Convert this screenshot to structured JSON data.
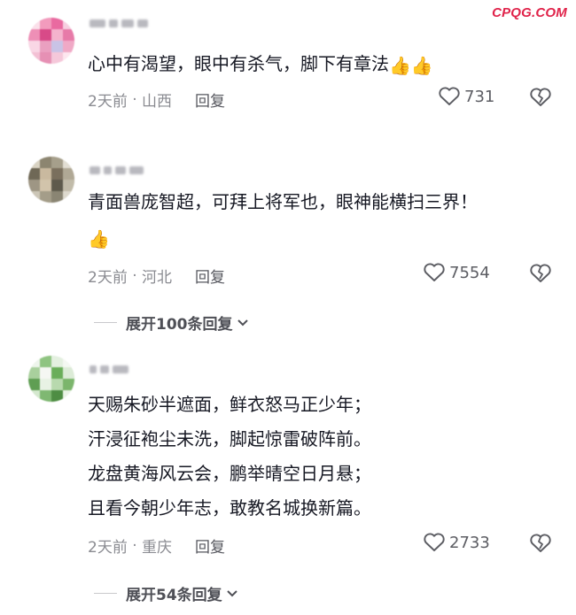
{
  "watermark": "CPQG.COM",
  "comments": [
    {
      "lines": [
        "心中有渴望，眼中有杀气，脚下有章法"
      ],
      "emoji": "👍👍",
      "time": "2天前",
      "location": "山西",
      "reply_label": "回复",
      "likes": "731"
    },
    {
      "lines": [
        "青面兽庞智超，可拜上将军也，眼神能横扫三界！"
      ],
      "emoji": "👍",
      "time": "2天前",
      "location": "河北",
      "reply_label": "回复",
      "likes": "7554",
      "expand_label": "展开100条回复"
    },
    {
      "lines": [
        "天赐朱砂半遮面，鲜衣怒马正少年；",
        "汗浸征袍尘未洗，脚起惊雷破阵前。",
        "龙盘黄海风云会，鹏举晴空日月悬；",
        "且看今朝少年志，敢教名城换新篇。"
      ],
      "time": "2天前",
      "location": "重庆",
      "reply_label": "回复",
      "likes": "2733",
      "expand_label": "展开54条回复"
    }
  ],
  "colors": {
    "accent": "#e0234a",
    "text": "#161823",
    "meta": "#8a8b91"
  },
  "icons": {
    "like": "heart-outline-icon",
    "dislike": "broken-heart-icon",
    "expand": "chevron-down-icon"
  }
}
